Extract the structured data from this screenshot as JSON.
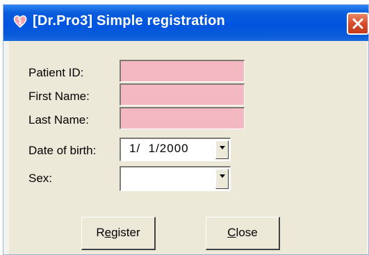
{
  "window": {
    "title": "[Dr.Pro3] Simple registration"
  },
  "form": {
    "patient_id_label": "Patient ID:",
    "patient_id_value": "",
    "first_name_label": "First Name:",
    "first_name_value": "",
    "last_name_label": "Last Name:",
    "last_name_value": "",
    "dob_label": "Date of birth:",
    "dob_value": "1/  1/2000",
    "sex_label": "Sex:",
    "sex_value": ""
  },
  "buttons": {
    "register_pre": "R",
    "register_mnemonic": "e",
    "register_post": "gister",
    "close_pre": "",
    "close_mnemonic": "C",
    "close_post": "lose"
  },
  "colors": {
    "required_field": "#f4b8c3",
    "titlebar": "#0054e0",
    "dialog_bg": "#ece9d8"
  }
}
